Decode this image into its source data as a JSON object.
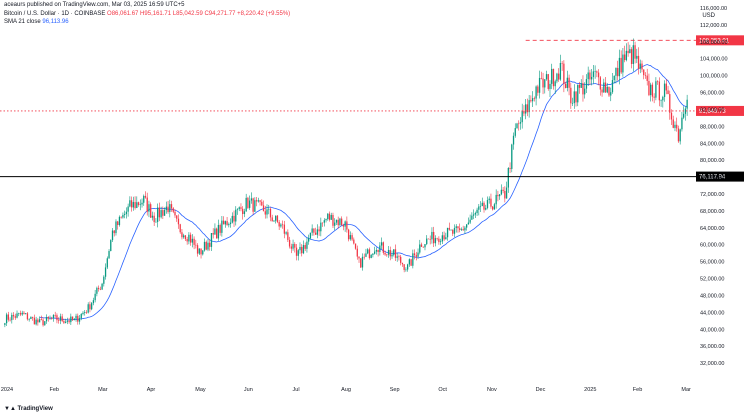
{
  "header": {
    "published_by": "aceaurs published on TradingView.com, Mar 03, 2025 16:59 UTC+5",
    "symbol_title": "Bitcoin / U.S. Dollar · 1D · COINBASE",
    "ohlc_text": "O86,061.67 H95,161.71 L85,042.59 C94,271.77 +8,220.42 (+9.55%)",
    "ma_label": "SMA 21 close",
    "ma_value": "96,113.96",
    "currency": "USD",
    "logo_text": "TradingView"
  },
  "colors": {
    "up": "#089981",
    "down": "#f23645",
    "ma": "#2962ff",
    "resistance": "#f23645",
    "support": "#000000"
  },
  "chart_data": {
    "type": "candlestick",
    "title": "Bitcoin / U.S. Dollar · 1D · COINBASE",
    "ylim": [
      28000,
      116000
    ],
    "y_ticks": [
      "116,000.00",
      "112,000.00",
      "108,000.00",
      "104,000.00",
      "100,000.00",
      "96,000.00",
      "92,000.00",
      "88,000.00",
      "84,000.00",
      "80,000.00",
      "76,000.00",
      "72,000.00",
      "68,000.00",
      "64,000.00",
      "60,000.00",
      "56,000.00",
      "52,000.00",
      "48,000.00",
      "44,000.00",
      "40,000.00",
      "36,000.00",
      "32,000.00"
    ],
    "y_tick_values": [
      116000,
      112000,
      108000,
      104000,
      100000,
      96000,
      92000,
      88000,
      84000,
      80000,
      76000,
      72000,
      68000,
      64000,
      60000,
      56000,
      52000,
      48000,
      44000,
      40000,
      36000,
      32000
    ],
    "x_tick_labels": [
      "2024",
      "Feb",
      "Mar",
      "Apr",
      "May",
      "Jun",
      "Jul",
      "Aug",
      "Sep",
      "Oct",
      "Nov",
      "Dec",
      "2025",
      "Feb",
      "Mar"
    ],
    "x_tick_index": [
      0,
      28,
      56,
      84,
      112,
      140,
      168,
      196,
      224,
      252,
      280,
      308,
      336,
      364,
      392
    ],
    "levels": [
      {
        "name": "resistance",
        "value": 108353.01,
        "label": "108,353.01",
        "style": "dashed"
      },
      {
        "name": "mid-level",
        "value": 91649.73,
        "label": "91,649.73",
        "style": "dotted"
      },
      {
        "name": "support",
        "value": 76117.94,
        "label": "76,117.94",
        "style": "solid"
      }
    ],
    "anchors": [
      [
        0,
        42500
      ],
      [
        10,
        43500
      ],
      [
        20,
        41500
      ],
      [
        28,
        42500
      ],
      [
        40,
        42000
      ],
      [
        48,
        45000
      ],
      [
        56,
        51000
      ],
      [
        62,
        63000
      ],
      [
        72,
        69000
      ],
      [
        80,
        70500
      ],
      [
        86,
        66500
      ],
      [
        94,
        69000
      ],
      [
        100,
        64000
      ],
      [
        106,
        62000
      ],
      [
        112,
        58000
      ],
      [
        122,
        63000
      ],
      [
        132,
        67000
      ],
      [
        140,
        70000
      ],
      [
        150,
        68000
      ],
      [
        160,
        64000
      ],
      [
        168,
        57000
      ],
      [
        176,
        62000
      ],
      [
        186,
        66500
      ],
      [
        196,
        65000
      ],
      [
        204,
        55500
      ],
      [
        214,
        60000
      ],
      [
        224,
        57500
      ],
      [
        232,
        54500
      ],
      [
        240,
        60500
      ],
      [
        252,
        62500
      ],
      [
        262,
        63000
      ],
      [
        272,
        67500
      ],
      [
        280,
        69500
      ],
      [
        288,
        72000
      ],
      [
        294,
        87000
      ],
      [
        300,
        91500
      ],
      [
        306,
        97000
      ],
      [
        314,
        99000
      ],
      [
        320,
        102000
      ],
      [
        326,
        95000
      ],
      [
        332,
        97000
      ],
      [
        340,
        100000
      ],
      [
        348,
        96500
      ],
      [
        356,
        104000
      ],
      [
        362,
        105000
      ],
      [
        370,
        97000
      ],
      [
        380,
        96000
      ],
      [
        388,
        86000
      ],
      [
        392,
        94300
      ]
    ]
  }
}
